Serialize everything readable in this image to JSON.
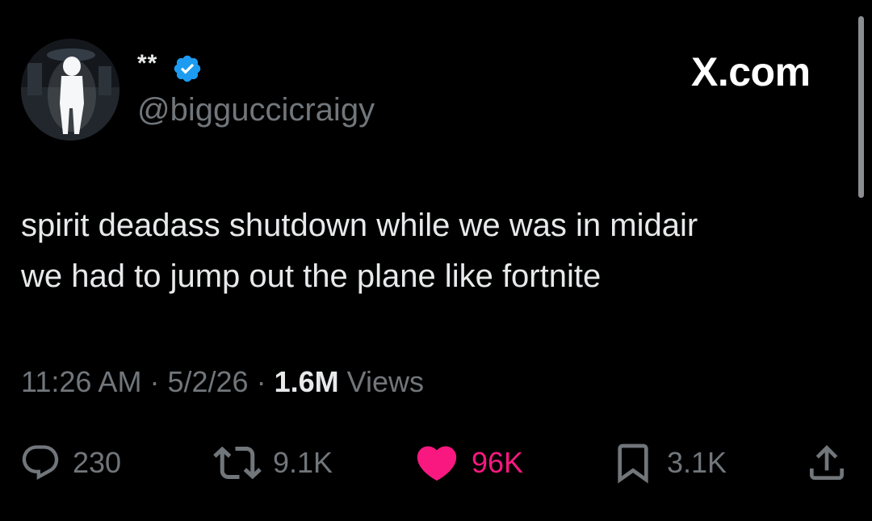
{
  "post": {
    "author": {
      "display_name": "**",
      "handle": "@bigguccicraigy",
      "verified_icon": "verified-badge-icon",
      "avatar": "profile-photo"
    },
    "brand": "X.com",
    "text_lines": [
      "spirit deadass shutdown while we was in midair",
      "we had to jump out the plane like fortnite"
    ],
    "meta": {
      "time": "11:26 AM",
      "sep1": "·",
      "date": "5/2/26",
      "sep2": "·",
      "views_count": "1.6M",
      "views_label": "Views"
    },
    "actions": {
      "replies": {
        "icon": "reply-icon",
        "count": "230"
      },
      "reposts": {
        "icon": "repost-icon",
        "count": "9.1K"
      },
      "likes": {
        "icon": "heart-icon",
        "count": "96K",
        "color": "#f91880"
      },
      "bookmarks": {
        "icon": "bookmark-icon",
        "count": "3.1K"
      },
      "share": {
        "icon": "share-icon"
      }
    }
  },
  "colors": {
    "background": "#000000",
    "primary_text": "#e7e9ea",
    "secondary_text": "#71767b",
    "verified": "#1d9bf0",
    "like": "#f91880"
  }
}
